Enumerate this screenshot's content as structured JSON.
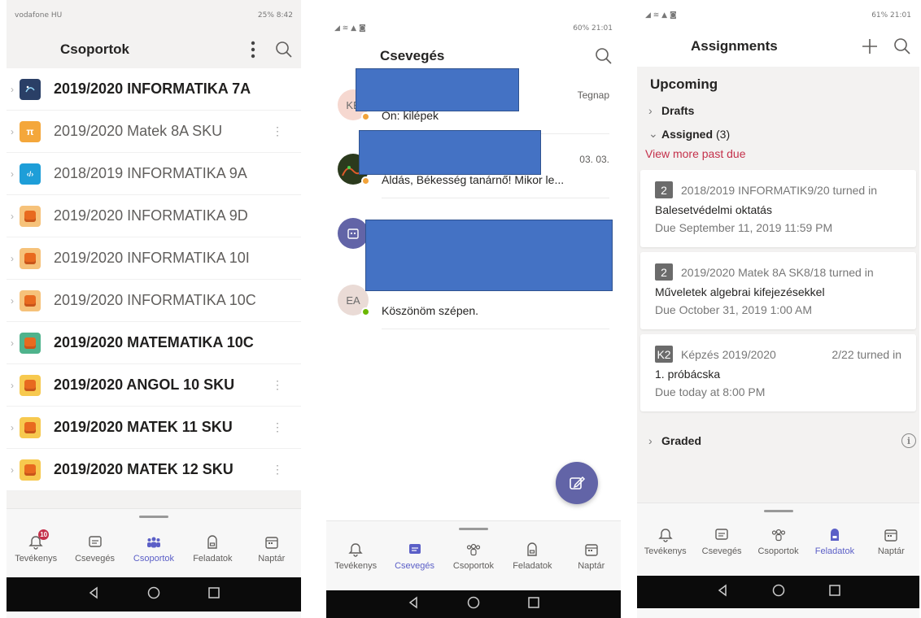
{
  "screens": {
    "teams": {
      "status_left": "vodafone HU",
      "status_right": "25% 8:42",
      "title": "Csoportok",
      "teams": [
        {
          "name": "2019/2020 INFORMATIKA 7A",
          "bold": true,
          "avatar": "teal"
        },
        {
          "name": "2019/2020 Matek 8A SKU",
          "bold": false,
          "avatar": "pi",
          "kebab": true
        },
        {
          "name": "2018/2019 INFORMATIKA  9A",
          "bold": false,
          "avatar": "code"
        },
        {
          "name": "2019/2020 INFORMATIKA 9D",
          "bold": false,
          "avatar": "orange"
        },
        {
          "name": "2019/2020 INFORMATIKA 10I",
          "bold": false,
          "avatar": "orange"
        },
        {
          "name": "2019/2020 INFORMATIKA 10C",
          "bold": false,
          "avatar": "orange"
        },
        {
          "name": "2019/2020 MATEMATIKA 10C",
          "bold": true,
          "avatar": "green"
        },
        {
          "name": "2019/2020 ANGOL 10 SKU",
          "bold": true,
          "avatar": "yellow",
          "kebab": true
        },
        {
          "name": "2019/2020 MATEK 11 SKU",
          "bold": true,
          "avatar": "yellow",
          "kebab": true
        },
        {
          "name": "2019/2020 MATEK 12 SKU",
          "bold": true,
          "avatar": "yellow",
          "kebab": true
        }
      ],
      "activity_badge": "10"
    },
    "chat": {
      "status_right": "60% 21:01",
      "title": "Csevegés",
      "chats": [
        {
          "initials": "KE",
          "time": "Tegnap",
          "message": "Ön: kilépek",
          "status_color": "#f2a33a"
        },
        {
          "initials": "",
          "time": "03. 03.",
          "message": "Áldás, Békesség tanárnő! Mikor le...",
          "status_color": "#f2a33a"
        },
        {
          "initials": "",
          "time": "",
          "message": "",
          "status_color": ""
        },
        {
          "initials": "EA",
          "time": "",
          "message": "Köszönöm szépen.",
          "status_color": "#6bb700"
        }
      ]
    },
    "assignments": {
      "status_right": "61% 21:01",
      "title": "Assignments",
      "upcoming": "Upcoming",
      "drafts": "Drafts",
      "assigned": "Assigned",
      "assigned_count": "(3)",
      "view_more": "View more past due",
      "cards": [
        {
          "badge": "2",
          "class_name": "2018/2019 INFORMATIK9/20 turned in",
          "turned": "",
          "title": "Balesetvédelmi oktatás",
          "due": "Due September 11, 2019 11:59 PM"
        },
        {
          "badge": "2",
          "class_name": "2019/2020 Matek 8A SK8/18 turned in",
          "turned": "",
          "title": "Műveletek algebrai kifejezésekkel",
          "due": "Due October 31, 2019 1:00 AM"
        },
        {
          "badge": "K2",
          "class_name": "Képzés 2019/2020",
          "turned": "2/22 turned in",
          "title": "1. próbácska",
          "due": "Due today at 8:00 PM"
        }
      ],
      "graded": "Graded"
    }
  },
  "tabs": {
    "activity": "Tevékenys",
    "activity_full": "Tevékenys",
    "chat": "Csevegés",
    "teams": "Csoportok",
    "assignments": "Feladatok",
    "calendar": "Naptár",
    "activity_p3": "Tevékenys",
    "calendar_p3": "Naptár"
  },
  "colors": {
    "accent": "#5b5fc7",
    "redaction": "#4472c4",
    "past_due": "#c4314b"
  }
}
